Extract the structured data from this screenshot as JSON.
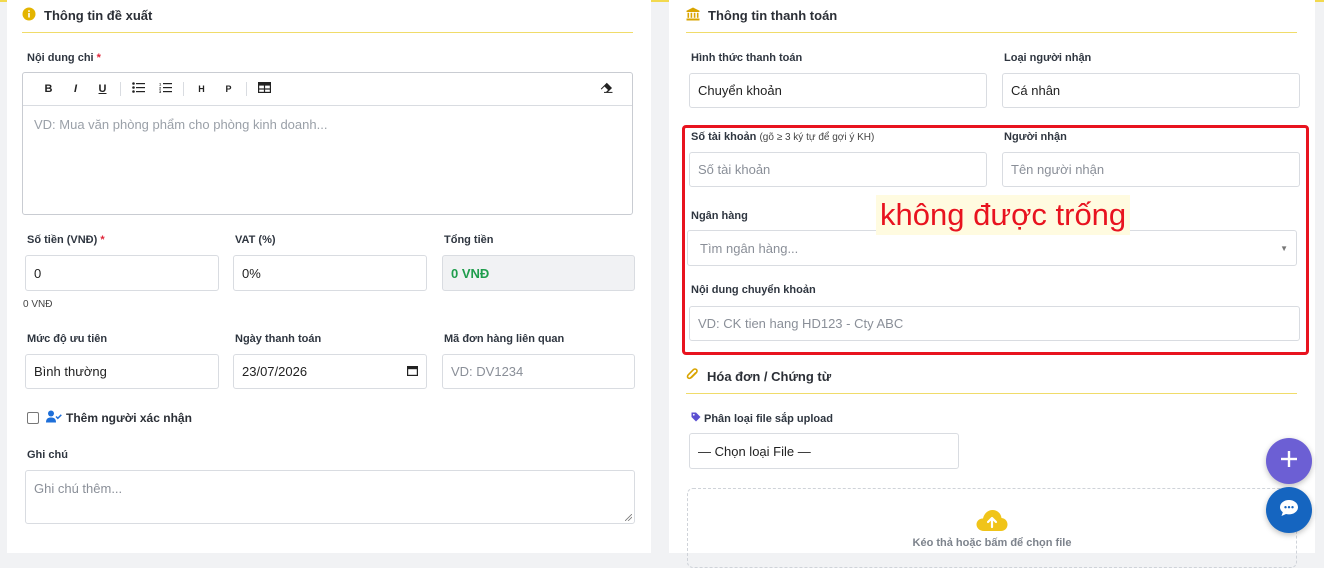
{
  "left": {
    "section_title": "Thông tin đề xuất",
    "content_label": "Nội dung chi",
    "required_mark": "*",
    "toolbar": {
      "bold": "B",
      "italic": "I",
      "underline": "U",
      "h": "H",
      "p": "P"
    },
    "editor_placeholder": "VD: Mua văn phòng phẩm cho phòng kinh doanh...",
    "amount_label": "Số tiền (VNĐ)",
    "amount_value": "0",
    "amount_note": "0 VNĐ",
    "vat_label": "VAT (%)",
    "vat_value": "0%",
    "total_label": "Tổng tiền",
    "total_value": "0 VNĐ",
    "priority_label": "Mức độ ưu tiên",
    "priority_value": "Bình thường",
    "pay_date_label": "Ngày thanh toán",
    "pay_date_value": "23/07/2026",
    "order_label": "Mã đơn hàng liên quan",
    "order_placeholder": "VD: DV1234",
    "add_confirmer_label": "Thêm người xác nhận",
    "note_label": "Ghi chú",
    "note_placeholder": "Ghi chú thêm..."
  },
  "right": {
    "section_title": "Thông tin thanh toán",
    "pay_method_label": "Hình thức thanh toán",
    "pay_method_value": "Chuyển khoản",
    "receiver_type_label": "Loại người nhận",
    "receiver_type_value": "Cá nhân",
    "account_label": "Số tài khoản",
    "account_hint": "(gõ ≥ 3 ký tự để gợi ý KH)",
    "account_placeholder": "Số tài khoản",
    "receiver_label": "Người nhận",
    "receiver_placeholder": "Tên người nhận",
    "bank_label": "Ngân hàng",
    "bank_placeholder": "Tìm ngân hàng...",
    "transfer_label": "Nội dung chuyển khoản",
    "transfer_placeholder": "VD: CK tien hang HD123 - Cty ABC",
    "annotation": "không được trống",
    "invoice_title": "Hóa đơn / Chứng từ",
    "file_type_label": "Phân loại file sắp upload",
    "file_type_value": "— Chọn loại File —",
    "dropzone_text": "Kéo thả hoặc bấm để chọn file"
  },
  "colors": {
    "accent": "#f2d94e",
    "error": "#e8131f",
    "success": "#1f9d4c",
    "fab_add": "#6c5fd4",
    "fab_chat": "#1565c0"
  },
  "icons": [
    "info-icon",
    "bank-icon",
    "paperclip-icon",
    "tag-icon",
    "user-check-icon",
    "calendar-icon",
    "cloud-upload-icon",
    "plus-icon",
    "chat-icon",
    "eraser-icon",
    "table-icon"
  ]
}
